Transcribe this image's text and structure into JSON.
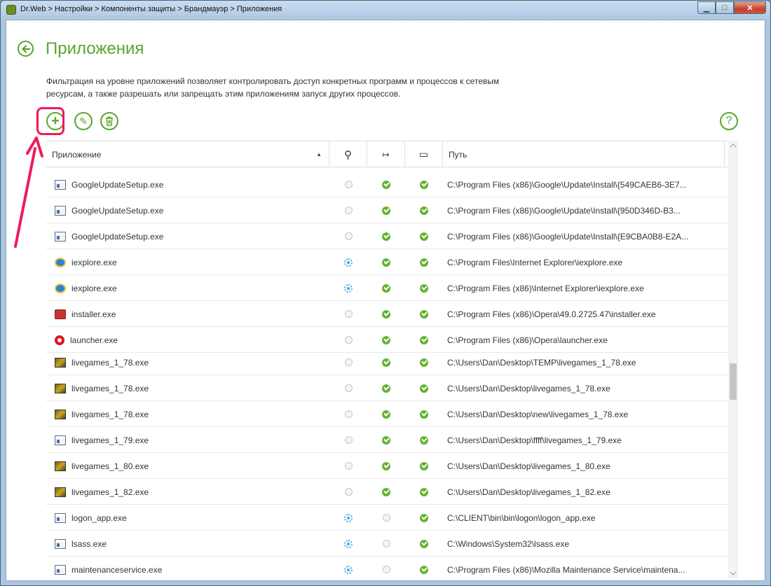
{
  "window": {
    "title": "Dr.Web > Настройки > Компоненты защиты > Брандмауэр > Приложения",
    "minimize_glyph": "▁",
    "maximize_glyph": "□",
    "close_glyph": "✕"
  },
  "page": {
    "title": "Приложения",
    "description": "Фильтрация на уровне приложений позволяет контролировать доступ конкретных программ и процессов к сетевым ресурсам, а также разрешать или запрещать этим приложениям запуск других процессов.",
    "help_glyph": "?"
  },
  "toolbar": {
    "add_glyph": "+",
    "edit_glyph": "✎",
    "delete_glyph": "🗑"
  },
  "table": {
    "columns": {
      "app": "Приложение",
      "sort_glyph": "▲",
      "col1_glyph": "⚲",
      "col2_glyph": "↦",
      "col3_glyph": "▭",
      "path": "Путь"
    },
    "rows": [
      {
        "name": "GoogleUpdateSetup.exe",
        "icon": "window-icon",
        "c1": "none",
        "c2": "check",
        "c3": "check",
        "path": "C:\\Program Files (x86)\\Google\\Update\\Install\\{549CAEB6-3E7..."
      },
      {
        "name": "GoogleUpdateSetup.exe",
        "icon": "window-icon",
        "c1": "none",
        "c2": "check",
        "c3": "check",
        "path": "C:\\Program Files (x86)\\Google\\Update\\Install\\{950D346D-B3..."
      },
      {
        "name": "GoogleUpdateSetup.exe",
        "icon": "window-icon",
        "c1": "none",
        "c2": "check",
        "c3": "check",
        "path": "C:\\Program Files (x86)\\Google\\Update\\Install\\{E9CBA0B8-E2A..."
      },
      {
        "name": "iexplore.exe",
        "icon": "ie-icon",
        "c1": "gear",
        "c2": "check",
        "c3": "check",
        "path": "C:\\Program Files\\Internet Explorer\\iexplore.exe"
      },
      {
        "name": "iexplore.exe",
        "icon": "ie-icon",
        "c1": "gear",
        "c2": "check",
        "c3": "check",
        "path": "C:\\Program Files (x86)\\Internet Explorer\\iexplore.exe"
      },
      {
        "name": "installer.exe",
        "icon": "installer-icon",
        "c1": "none",
        "c2": "check",
        "c3": "check",
        "path": "C:\\Program Files (x86)\\Opera\\49.0.2725.47\\installer.exe"
      },
      {
        "name": "launcher.exe",
        "icon": "opera-icon",
        "c1": "none",
        "c2": "check",
        "c3": "check",
        "path": "C:\\Program Files (x86)\\Opera\\launcher.exe"
      },
      {
        "name": "livegames_1_78.exe",
        "icon": "game-icon",
        "c1": "none",
        "c2": "check",
        "c3": "check",
        "path": "C:\\Users\\Dan\\Desktop\\TEMP\\livegames_1_78.exe"
      },
      {
        "name": "livegames_1_78.exe",
        "icon": "game-icon",
        "c1": "none",
        "c2": "check",
        "c3": "check",
        "path": "C:\\Users\\Dan\\Desktop\\livegames_1_78.exe"
      },
      {
        "name": "livegames_1_78.exe",
        "icon": "game-icon",
        "c1": "none",
        "c2": "check",
        "c3": "check",
        "path": "C:\\Users\\Dan\\Desktop\\new\\livegames_1_78.exe"
      },
      {
        "name": "livegames_1_79.exe",
        "icon": "window-icon",
        "c1": "none",
        "c2": "check",
        "c3": "check",
        "path": "C:\\Users\\Dan\\Desktop\\ffff\\livegames_1_79.exe"
      },
      {
        "name": "livegames_1_80.exe",
        "icon": "game-icon",
        "c1": "none",
        "c2": "check",
        "c3": "check",
        "path": "C:\\Users\\Dan\\Desktop\\livegames_1_80.exe"
      },
      {
        "name": "livegames_1_82.exe",
        "icon": "game-icon",
        "c1": "none",
        "c2": "check",
        "c3": "check",
        "path": "C:\\Users\\Dan\\Desktop\\livegames_1_82.exe"
      },
      {
        "name": "logon_app.exe",
        "icon": "window-icon",
        "c1": "gear",
        "c2": "none",
        "c3": "check",
        "path": "C:\\CLIENT\\bin\\bin\\logon\\logon_app.exe"
      },
      {
        "name": "lsass.exe",
        "icon": "window-icon",
        "c1": "gear",
        "c2": "none",
        "c3": "check",
        "path": "C:\\Windows\\System32\\lsass.exe"
      },
      {
        "name": "maintenanceservice.exe",
        "icon": "window-icon",
        "c1": "gear",
        "c2": "none",
        "c3": "check",
        "path": "C:\\Program Files (x86)\\Mozilla Maintenance Service\\maintena..."
      }
    ]
  },
  "colors": {
    "accent": "#5aa52f",
    "check": "#63b330",
    "gear": "#4ba6d8",
    "highlight": "#ee1c5a"
  }
}
